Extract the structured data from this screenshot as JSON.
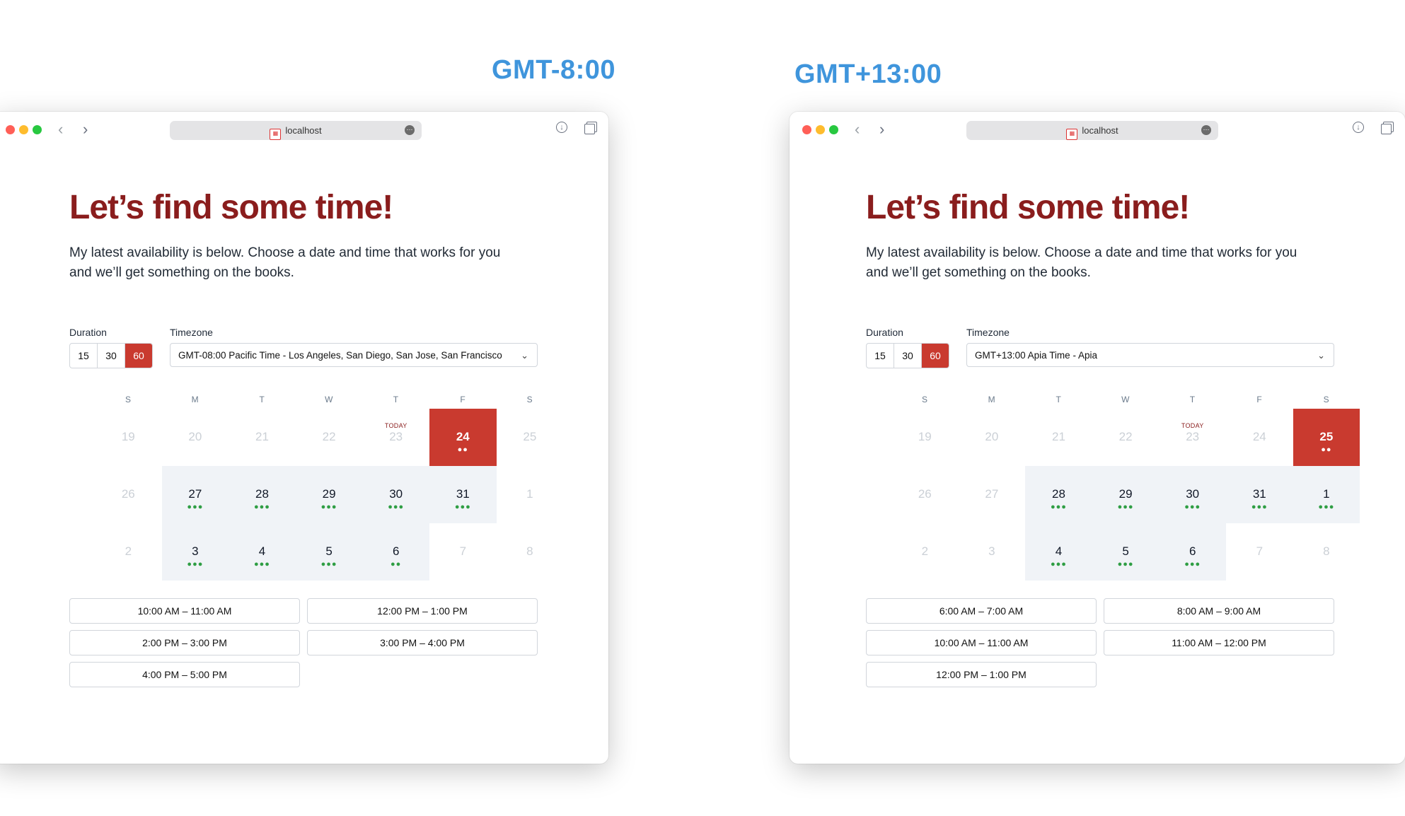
{
  "labels": {
    "left": "GMT-8:00",
    "right": "GMT+13:00"
  },
  "colors": {
    "accent": "#c93a2f",
    "heading": "#8a1d1d",
    "label_blue": "#3f95dc",
    "available_dot": "#2f9e44"
  },
  "windows": [
    {
      "url": "localhost",
      "heading": "Let’s find some time!",
      "intro": "My latest availability is below. Choose a date and time that works for you and we’ll get something on the books.",
      "duration_label": "Duration",
      "durations": [
        "15",
        "30",
        "60"
      ],
      "duration_selected": "60",
      "timezone_label": "Timezone",
      "timezone_value": "GMT-08:00 Pacific Time - Los Angeles, San Diego, San Jose, San Francisco",
      "weekdays": [
        "S",
        "M",
        "T",
        "W",
        "T",
        "F",
        "S"
      ],
      "today_label": "TODAY",
      "calendar": [
        [
          {
            "d": "19"
          },
          {
            "d": "20"
          },
          {
            "d": "21"
          },
          {
            "d": "22"
          },
          {
            "d": "23",
            "today": true
          },
          {
            "d": "24",
            "selected": true,
            "dots": 2
          },
          {
            "d": "25"
          }
        ],
        [
          {
            "d": "26"
          },
          {
            "d": "27",
            "dots": 3
          },
          {
            "d": "28",
            "dots": 3
          },
          {
            "d": "29",
            "dots": 3
          },
          {
            "d": "30",
            "dots": 3
          },
          {
            "d": "31",
            "dots": 3
          },
          {
            "d": "1"
          }
        ],
        [
          {
            "d": "2"
          },
          {
            "d": "3",
            "dots": 3
          },
          {
            "d": "4",
            "dots": 3
          },
          {
            "d": "5",
            "dots": 3
          },
          {
            "d": "6",
            "dots": 2
          },
          {
            "d": "7"
          },
          {
            "d": "8"
          }
        ]
      ],
      "slots": [
        "10:00 AM – 11:00 AM",
        "12:00 PM – 1:00 PM",
        "2:00 PM – 3:00 PM",
        "3:00 PM – 4:00 PM",
        "4:00 PM – 5:00 PM"
      ]
    },
    {
      "url": "localhost",
      "heading": "Let’s find some time!",
      "intro": "My latest availability is below. Choose a date and time that works for you and we’ll get something on the books.",
      "duration_label": "Duration",
      "durations": [
        "15",
        "30",
        "60"
      ],
      "duration_selected": "60",
      "timezone_label": "Timezone",
      "timezone_value": "GMT+13:00 Apia Time - Apia",
      "weekdays": [
        "S",
        "M",
        "T",
        "W",
        "T",
        "F",
        "S"
      ],
      "today_label": "TODAY",
      "calendar": [
        [
          {
            "d": "19"
          },
          {
            "d": "20"
          },
          {
            "d": "21"
          },
          {
            "d": "22"
          },
          {
            "d": "23",
            "today": true
          },
          {
            "d": "24"
          },
          {
            "d": "25",
            "selected": true,
            "dots": 2
          }
        ],
        [
          {
            "d": "26"
          },
          {
            "d": "27"
          },
          {
            "d": "28",
            "dots": 3
          },
          {
            "d": "29",
            "dots": 3
          },
          {
            "d": "30",
            "dots": 3
          },
          {
            "d": "31",
            "dots": 3
          },
          {
            "d": "1",
            "dots": 3
          }
        ],
        [
          {
            "d": "2"
          },
          {
            "d": "3"
          },
          {
            "d": "4",
            "dots": 3
          },
          {
            "d": "5",
            "dots": 3
          },
          {
            "d": "6",
            "dots": 3
          },
          {
            "d": "7"
          },
          {
            "d": "8"
          }
        ]
      ],
      "slots": [
        "6:00 AM – 7:00 AM",
        "8:00 AM – 9:00 AM",
        "10:00 AM – 11:00 AM",
        "11:00 AM – 12:00 PM",
        "12:00 PM – 1:00 PM"
      ]
    }
  ]
}
